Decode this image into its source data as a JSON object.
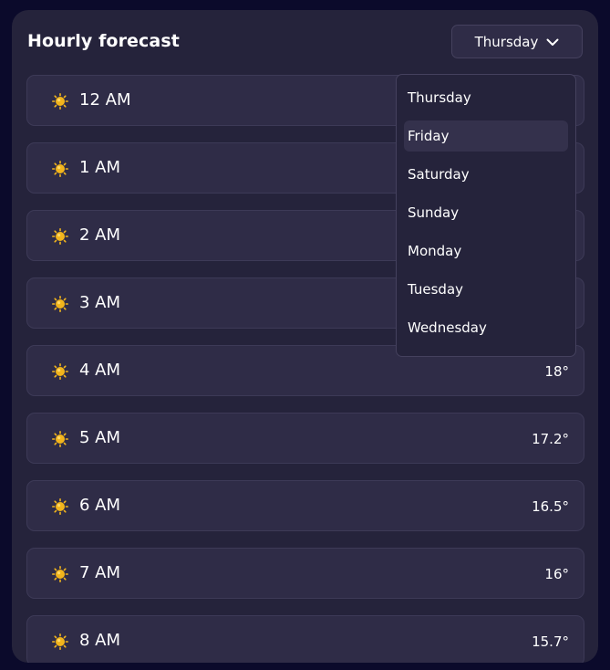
{
  "header": {
    "title": "Hourly forecast",
    "selected_day": "Thursday"
  },
  "dropdown": {
    "options": [
      "Thursday",
      "Friday",
      "Saturday",
      "Sunday",
      "Monday",
      "Tuesday",
      "Wednesday"
    ],
    "highlighted": "Friday"
  },
  "hours": [
    {
      "time": "12 AM",
      "temp": "",
      "icon": "sun-icon"
    },
    {
      "time": "1 AM",
      "temp": "",
      "icon": "sun-icon"
    },
    {
      "time": "2 AM",
      "temp": "",
      "icon": "sun-icon"
    },
    {
      "time": "3 AM",
      "temp": "",
      "icon": "sun-icon"
    },
    {
      "time": "4 AM",
      "temp": "18°",
      "icon": "sun-icon"
    },
    {
      "time": "5 AM",
      "temp": "17.2°",
      "icon": "sun-icon"
    },
    {
      "time": "6 AM",
      "temp": "16.5°",
      "icon": "sun-icon"
    },
    {
      "time": "7 AM",
      "temp": "16°",
      "icon": "sun-icon"
    },
    {
      "time": "8 AM",
      "temp": "15.7°",
      "icon": "sun-icon"
    }
  ],
  "colors": {
    "background": "#0b0a2b",
    "panel": "#25233b",
    "row": "#2f2c47",
    "border": "#3d3a57",
    "sun": "#f2b51c"
  }
}
